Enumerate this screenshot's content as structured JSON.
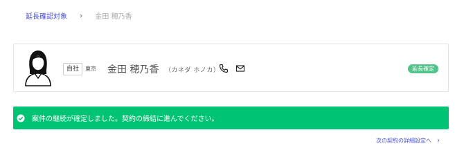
{
  "breadcrumb": {
    "parent": "延長確認対象",
    "separator": "›",
    "current": "金田 穂乃香"
  },
  "person": {
    "tag": "自社",
    "area": "東京",
    "name": "金田 穂乃香",
    "kana": "（カネダ ホノカ）",
    "status": "延長確定"
  },
  "alert": {
    "message": "案件の継続が確定しました。契約の締結に進んでください。"
  },
  "footer": {
    "next_link": "次の契約の詳細設定へ",
    "chevron": "›"
  },
  "colors": {
    "accent": "#4a4fd6",
    "success": "#00c474",
    "status_badge": "#4fc48a"
  },
  "icons": [
    "avatar-icon",
    "phone-icon",
    "mail-icon",
    "check-circle-icon",
    "chevron-right-icon"
  ]
}
